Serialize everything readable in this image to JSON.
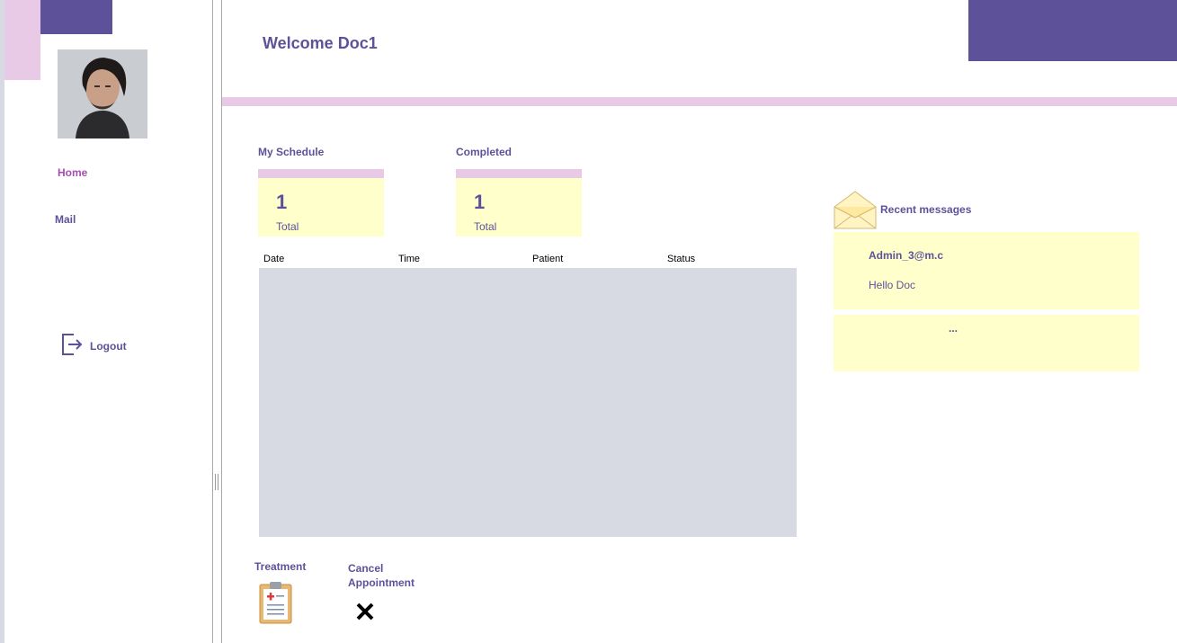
{
  "header": {
    "welcome": "Welcome Doc1"
  },
  "sidebar": {
    "items": [
      {
        "label": "Home"
      },
      {
        "label": "Mail"
      }
    ],
    "logout": "Logout"
  },
  "stats": {
    "schedule": {
      "label": "My Schedule",
      "value": "1",
      "caption": "Total"
    },
    "completed": {
      "label": "Completed",
      "value": "1",
      "caption": "Total"
    }
  },
  "table": {
    "columns": [
      "Date",
      "Time",
      "Patient",
      "Status"
    ],
    "rows": []
  },
  "actions": {
    "treatment": "Treatment",
    "cancel": "Cancel Appointment"
  },
  "messages": {
    "title": "Recent messages",
    "items": [
      {
        "sender": "Admin_3@m.c",
        "body": "Hello Doc"
      }
    ],
    "more": "..."
  },
  "colors": {
    "brand_purple": "#5d5299",
    "light_pink": "#e8c9e6",
    "card_yellow": "#ffffcc",
    "table_gray": "#d7dae3",
    "active_nav": "#a64db0"
  },
  "icons": {
    "avatar": "user-avatar",
    "logout": "logout-icon",
    "treatment": "clipboard-icon",
    "cancel": "close-icon",
    "messages": "envelope-icon"
  }
}
